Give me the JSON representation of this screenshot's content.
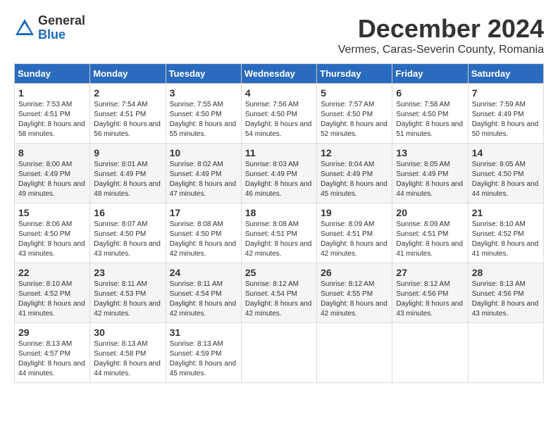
{
  "logo": {
    "general": "General",
    "blue": "Blue"
  },
  "title": "December 2024",
  "subtitle": "Vermes, Caras-Severin County, Romania",
  "headers": [
    "Sunday",
    "Monday",
    "Tuesday",
    "Wednesday",
    "Thursday",
    "Friday",
    "Saturday"
  ],
  "weeks": [
    [
      {
        "day": "1",
        "sunrise": "Sunrise: 7:53 AM",
        "sunset": "Sunset: 4:51 PM",
        "daylight": "Daylight: 8 hours and 58 minutes."
      },
      {
        "day": "2",
        "sunrise": "Sunrise: 7:54 AM",
        "sunset": "Sunset: 4:51 PM",
        "daylight": "Daylight: 8 hours and 56 minutes."
      },
      {
        "day": "3",
        "sunrise": "Sunrise: 7:55 AM",
        "sunset": "Sunset: 4:50 PM",
        "daylight": "Daylight: 8 hours and 55 minutes."
      },
      {
        "day": "4",
        "sunrise": "Sunrise: 7:56 AM",
        "sunset": "Sunset: 4:50 PM",
        "daylight": "Daylight: 8 hours and 54 minutes."
      },
      {
        "day": "5",
        "sunrise": "Sunrise: 7:57 AM",
        "sunset": "Sunset: 4:50 PM",
        "daylight": "Daylight: 8 hours and 52 minutes."
      },
      {
        "day": "6",
        "sunrise": "Sunrise: 7:58 AM",
        "sunset": "Sunset: 4:50 PM",
        "daylight": "Daylight: 8 hours and 51 minutes."
      },
      {
        "day": "7",
        "sunrise": "Sunrise: 7:59 AM",
        "sunset": "Sunset: 4:49 PM",
        "daylight": "Daylight: 8 hours and 50 minutes."
      }
    ],
    [
      {
        "day": "8",
        "sunrise": "Sunrise: 8:00 AM",
        "sunset": "Sunset: 4:49 PM",
        "daylight": "Daylight: 8 hours and 49 minutes."
      },
      {
        "day": "9",
        "sunrise": "Sunrise: 8:01 AM",
        "sunset": "Sunset: 4:49 PM",
        "daylight": "Daylight: 8 hours and 48 minutes."
      },
      {
        "day": "10",
        "sunrise": "Sunrise: 8:02 AM",
        "sunset": "Sunset: 4:49 PM",
        "daylight": "Daylight: 8 hours and 47 minutes."
      },
      {
        "day": "11",
        "sunrise": "Sunrise: 8:03 AM",
        "sunset": "Sunset: 4:49 PM",
        "daylight": "Daylight: 8 hours and 46 minutes."
      },
      {
        "day": "12",
        "sunrise": "Sunrise: 8:04 AM",
        "sunset": "Sunset: 4:49 PM",
        "daylight": "Daylight: 8 hours and 45 minutes."
      },
      {
        "day": "13",
        "sunrise": "Sunrise: 8:05 AM",
        "sunset": "Sunset: 4:49 PM",
        "daylight": "Daylight: 8 hours and 44 minutes."
      },
      {
        "day": "14",
        "sunrise": "Sunrise: 8:05 AM",
        "sunset": "Sunset: 4:50 PM",
        "daylight": "Daylight: 8 hours and 44 minutes."
      }
    ],
    [
      {
        "day": "15",
        "sunrise": "Sunrise: 8:06 AM",
        "sunset": "Sunset: 4:50 PM",
        "daylight": "Daylight: 8 hours and 43 minutes."
      },
      {
        "day": "16",
        "sunrise": "Sunrise: 8:07 AM",
        "sunset": "Sunset: 4:50 PM",
        "daylight": "Daylight: 8 hours and 43 minutes."
      },
      {
        "day": "17",
        "sunrise": "Sunrise: 8:08 AM",
        "sunset": "Sunset: 4:50 PM",
        "daylight": "Daylight: 8 hours and 42 minutes."
      },
      {
        "day": "18",
        "sunrise": "Sunrise: 8:08 AM",
        "sunset": "Sunset: 4:51 PM",
        "daylight": "Daylight: 8 hours and 42 minutes."
      },
      {
        "day": "19",
        "sunrise": "Sunrise: 8:09 AM",
        "sunset": "Sunset: 4:51 PM",
        "daylight": "Daylight: 8 hours and 42 minutes."
      },
      {
        "day": "20",
        "sunrise": "Sunrise: 8:09 AM",
        "sunset": "Sunset: 4:51 PM",
        "daylight": "Daylight: 8 hours and 41 minutes."
      },
      {
        "day": "21",
        "sunrise": "Sunrise: 8:10 AM",
        "sunset": "Sunset: 4:52 PM",
        "daylight": "Daylight: 8 hours and 41 minutes."
      }
    ],
    [
      {
        "day": "22",
        "sunrise": "Sunrise: 8:10 AM",
        "sunset": "Sunset: 4:52 PM",
        "daylight": "Daylight: 8 hours and 41 minutes."
      },
      {
        "day": "23",
        "sunrise": "Sunrise: 8:11 AM",
        "sunset": "Sunset: 4:53 PM",
        "daylight": "Daylight: 8 hours and 42 minutes."
      },
      {
        "day": "24",
        "sunrise": "Sunrise: 8:11 AM",
        "sunset": "Sunset: 4:54 PM",
        "daylight": "Daylight: 8 hours and 42 minutes."
      },
      {
        "day": "25",
        "sunrise": "Sunrise: 8:12 AM",
        "sunset": "Sunset: 4:54 PM",
        "daylight": "Daylight: 8 hours and 42 minutes."
      },
      {
        "day": "26",
        "sunrise": "Sunrise: 8:12 AM",
        "sunset": "Sunset: 4:55 PM",
        "daylight": "Daylight: 8 hours and 42 minutes."
      },
      {
        "day": "27",
        "sunrise": "Sunrise: 8:12 AM",
        "sunset": "Sunset: 4:56 PM",
        "daylight": "Daylight: 8 hours and 43 minutes."
      },
      {
        "day": "28",
        "sunrise": "Sunrise: 8:13 AM",
        "sunset": "Sunset: 4:56 PM",
        "daylight": "Daylight: 8 hours and 43 minutes."
      }
    ],
    [
      {
        "day": "29",
        "sunrise": "Sunrise: 8:13 AM",
        "sunset": "Sunset: 4:57 PM",
        "daylight": "Daylight: 8 hours and 44 minutes."
      },
      {
        "day": "30",
        "sunrise": "Sunrise: 8:13 AM",
        "sunset": "Sunset: 4:58 PM",
        "daylight": "Daylight: 8 hours and 44 minutes."
      },
      {
        "day": "31",
        "sunrise": "Sunrise: 8:13 AM",
        "sunset": "Sunset: 4:59 PM",
        "daylight": "Daylight: 8 hours and 45 minutes."
      },
      null,
      null,
      null,
      null
    ]
  ]
}
